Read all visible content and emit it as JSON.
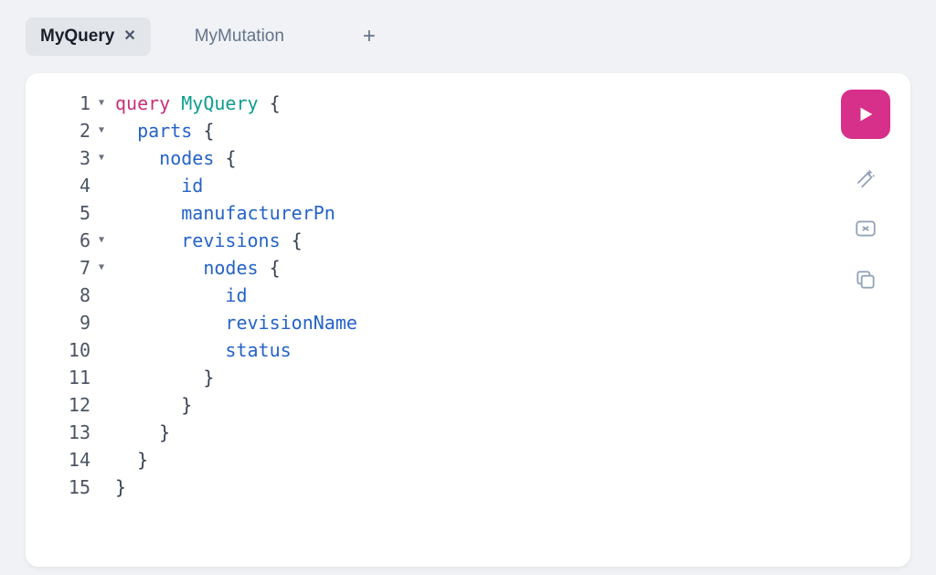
{
  "tabs": {
    "active": {
      "label": "MyQuery"
    },
    "inactive": {
      "label": "MyMutation"
    }
  },
  "actionButton": {
    "runColor": "#d6308a"
  },
  "code": {
    "lines": [
      {
        "num": "1",
        "fold": true,
        "tokens": [
          {
            "t": "keyword",
            "v": "query"
          },
          {
            "t": "sp",
            "v": " "
          },
          {
            "t": "name",
            "v": "MyQuery"
          },
          {
            "t": "sp",
            "v": " "
          },
          {
            "t": "punc",
            "v": "{"
          }
        ]
      },
      {
        "num": "2",
        "fold": true,
        "tokens": [
          {
            "t": "sp",
            "v": "  "
          },
          {
            "t": "field",
            "v": "parts"
          },
          {
            "t": "sp",
            "v": " "
          },
          {
            "t": "punc",
            "v": "{"
          }
        ]
      },
      {
        "num": "3",
        "fold": true,
        "tokens": [
          {
            "t": "sp",
            "v": "    "
          },
          {
            "t": "field",
            "v": "nodes"
          },
          {
            "t": "sp",
            "v": " "
          },
          {
            "t": "punc",
            "v": "{"
          }
        ]
      },
      {
        "num": "4",
        "fold": false,
        "tokens": [
          {
            "t": "sp",
            "v": "      "
          },
          {
            "t": "field",
            "v": "id"
          }
        ]
      },
      {
        "num": "5",
        "fold": false,
        "tokens": [
          {
            "t": "sp",
            "v": "      "
          },
          {
            "t": "field",
            "v": "manufacturerPn"
          }
        ]
      },
      {
        "num": "6",
        "fold": true,
        "tokens": [
          {
            "t": "sp",
            "v": "      "
          },
          {
            "t": "field",
            "v": "revisions"
          },
          {
            "t": "sp",
            "v": " "
          },
          {
            "t": "punc",
            "v": "{"
          }
        ]
      },
      {
        "num": "7",
        "fold": true,
        "tokens": [
          {
            "t": "sp",
            "v": "        "
          },
          {
            "t": "field",
            "v": "nodes"
          },
          {
            "t": "sp",
            "v": " "
          },
          {
            "t": "punc",
            "v": "{"
          }
        ]
      },
      {
        "num": "8",
        "fold": false,
        "tokens": [
          {
            "t": "sp",
            "v": "          "
          },
          {
            "t": "field",
            "v": "id"
          }
        ]
      },
      {
        "num": "9",
        "fold": false,
        "tokens": [
          {
            "t": "sp",
            "v": "          "
          },
          {
            "t": "field",
            "v": "revisionName"
          }
        ]
      },
      {
        "num": "10",
        "fold": false,
        "tokens": [
          {
            "t": "sp",
            "v": "          "
          },
          {
            "t": "field",
            "v": "status"
          }
        ]
      },
      {
        "num": "11",
        "fold": false,
        "tokens": [
          {
            "t": "sp",
            "v": "        "
          },
          {
            "t": "punc",
            "v": "}"
          }
        ]
      },
      {
        "num": "12",
        "fold": false,
        "tokens": [
          {
            "t": "sp",
            "v": "      "
          },
          {
            "t": "punc",
            "v": "}"
          }
        ]
      },
      {
        "num": "13",
        "fold": false,
        "tokens": [
          {
            "t": "sp",
            "v": "    "
          },
          {
            "t": "punc",
            "v": "}"
          }
        ]
      },
      {
        "num": "14",
        "fold": false,
        "tokens": [
          {
            "t": "sp",
            "v": "  "
          },
          {
            "t": "punc",
            "v": "}"
          }
        ]
      },
      {
        "num": "15",
        "fold": false,
        "tokens": [
          {
            "t": "punc",
            "v": "}"
          }
        ]
      }
    ]
  }
}
